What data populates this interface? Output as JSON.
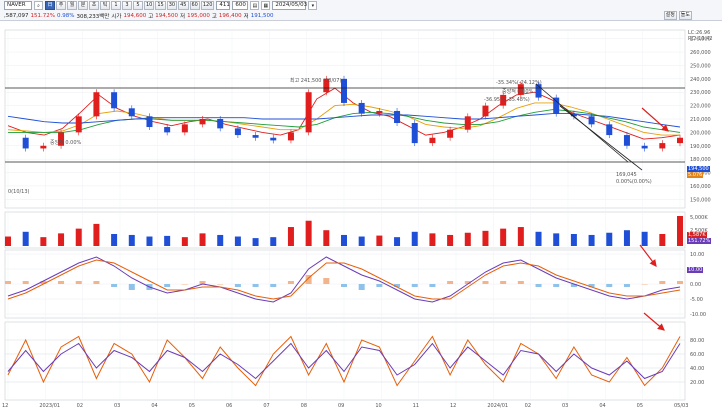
{
  "toolbar": {
    "stock_name": "NAVER",
    "period_buttons": [
      "日",
      "주",
      "월",
      "분",
      "초",
      "틱",
      "1",
      "3",
      "5",
      "10",
      "15",
      "30",
      "45",
      "60",
      "120"
    ],
    "active_period": "日",
    "count_value": "411",
    "count_field": "600",
    "date_value": "2024/05/03",
    "right_buttons": [
      "설정",
      "돌도"
    ],
    "price_line": {
      "volume": ",587,097",
      "change_pct": "151.72%",
      "shares": "0.98%",
      "turnover": "308,233백만",
      "open_label": "시가",
      "open": "194,600",
      "high_label": "고",
      "high": "194,500",
      "low_label": "저",
      "low": "195,000",
      "low2_label": "고",
      "low2": "196,400",
      "close_label": "저",
      "close": "191,500"
    }
  },
  "chart_data": {
    "type": "line",
    "price_axis": {
      "ticks": [
        "270,000",
        "260,000",
        "250,000",
        "240,000",
        "230,000",
        "220,000",
        "210,000",
        "200,000",
        "190,000",
        "180,000",
        "170,000",
        "160,000",
        "150,000"
      ],
      "ylim": [
        145000,
        275000
      ]
    },
    "x_ticks": [
      "12",
      "2023/01",
      "02",
      "03",
      "04",
      "05",
      "06",
      "07",
      "08",
      "09",
      "10",
      "11",
      "12",
      "2024/01",
      "02",
      "03",
      "04",
      "05",
      "05/03"
    ],
    "annotations": {
      "high_label": "최고 241,500 (08/07)",
      "fib_top": "-35.34%(-24.12%)",
      "fib_1": "중앙적 0.00%",
      "fib_2": "-36.95%(-35.48%)",
      "low_label": "169,045",
      "low_sub": "0.00%(0.00%)",
      "support_label": "중앙적 0.00%",
      "range_label": "0(10/13)",
      "top_right_1": "LC:26.96",
      "top_right_2": "RC:-19.42",
      "last_price": "194,500",
      "last_change": "5.076"
    },
    "ma_series": [
      {
        "values": [
          205,
          200,
          198,
          203,
          215,
          228,
          218,
          212,
          208,
          205,
          208,
          210,
          206,
          203,
          200,
          198,
          202,
          225,
          233,
          222,
          215,
          212,
          205,
          198,
          200,
          204,
          210,
          220,
          228,
          230,
          224,
          215,
          210,
          205,
          200,
          195,
          196,
          198
        ]
      },
      {
        "values": [
          202,
          201,
          200,
          201,
          206,
          214,
          216,
          214,
          211,
          209,
          209,
          209,
          208,
          206,
          204,
          202,
          202,
          210,
          220,
          221,
          219,
          216,
          212,
          206,
          204,
          203,
          205,
          211,
          218,
          222,
          222,
          219,
          215,
          210,
          205,
          200,
          198,
          198
        ]
      },
      {
        "values": [
          200,
          200,
          200,
          200,
          202,
          206,
          209,
          210,
          210,
          209,
          209,
          209,
          208,
          207,
          206,
          205,
          204,
          206,
          211,
          214,
          215,
          214,
          212,
          209,
          207,
          206,
          206,
          208,
          212,
          215,
          217,
          216,
          214,
          211,
          208,
          204,
          202,
          200
        ]
      },
      {
        "values": [
          212,
          210,
          208,
          207,
          207,
          208,
          209,
          210,
          211,
          211,
          211,
          211,
          211,
          211,
          210,
          210,
          210,
          210,
          211,
          212,
          213,
          213,
          213,
          212,
          211,
          210,
          210,
          211,
          212,
          213,
          214,
          214,
          213,
          212,
          210,
          208,
          206,
          204
        ]
      }
    ],
    "price_series": [
      196,
      188,
      190,
      200,
      212,
      230,
      218,
      212,
      204,
      200,
      206,
      210,
      203,
      198,
      196,
      194,
      200,
      230,
      240,
      222,
      214,
      216,
      207,
      192,
      196,
      202,
      212,
      220,
      228,
      236,
      226,
      214,
      212,
      206,
      198,
      190,
      188,
      192,
      196
    ],
    "volume": {
      "tick_top": "5,000K",
      "tick_mid": "2,500K",
      "last_value": "1,587K",
      "last_pct": "151.72%",
      "values": [
        30,
        45,
        28,
        40,
        55,
        70,
        38,
        35,
        30,
        32,
        28,
        40,
        35,
        30,
        25,
        28,
        60,
        80,
        50,
        35,
        30,
        33,
        28,
        45,
        40,
        35,
        42,
        48,
        55,
        60,
        45,
        40,
        38,
        35,
        42,
        50,
        45,
        38,
        95
      ]
    },
    "macd": {
      "ticks": [
        "10.00",
        "5.00",
        "0.00",
        "-5.00",
        "-10.00"
      ],
      "last": "10.00",
      "macd_values": [
        -4,
        -2,
        1,
        4,
        7,
        9,
        6,
        2,
        -1,
        -3,
        -2,
        0,
        -1,
        -3,
        -5,
        -6,
        -3,
        5,
        9,
        6,
        3,
        1,
        -2,
        -5,
        -6,
        -4,
        0,
        4,
        7,
        8,
        5,
        2,
        0,
        -2,
        -4,
        -5,
        -4,
        -2,
        -1
      ],
      "signal_values": [
        -5,
        -3,
        0,
        3,
        6,
        8,
        7,
        4,
        1,
        -2,
        -2,
        -1,
        -1,
        -2,
        -4,
        -5,
        -4,
        2,
        7,
        7,
        5,
        2,
        -1,
        -4,
        -5,
        -5,
        -1,
        3,
        6,
        7,
        6,
        3,
        1,
        -1,
        -3,
        -4,
        -4,
        -3,
        -2
      ]
    },
    "stochastic": {
      "ticks": [
        "80.00",
        "60.00",
        "40.00",
        "20.00"
      ],
      "k_values": [
        30,
        80,
        20,
        70,
        85,
        25,
        75,
        60,
        20,
        80,
        55,
        25,
        70,
        40,
        15,
        60,
        85,
        30,
        75,
        20,
        80,
        70,
        15,
        50,
        85,
        30,
        80,
        45,
        20,
        75,
        60,
        25,
        70,
        30,
        20,
        55,
        15,
        40,
        85
      ],
      "d_values": [
        35,
        65,
        35,
        60,
        75,
        40,
        65,
        55,
        35,
        65,
        55,
        35,
        60,
        45,
        25,
        50,
        75,
        40,
        65,
        35,
        70,
        65,
        30,
        45,
        75,
        40,
        70,
        50,
        30,
        65,
        60,
        35,
        60,
        40,
        30,
        50,
        25,
        35,
        75
      ]
    }
  }
}
